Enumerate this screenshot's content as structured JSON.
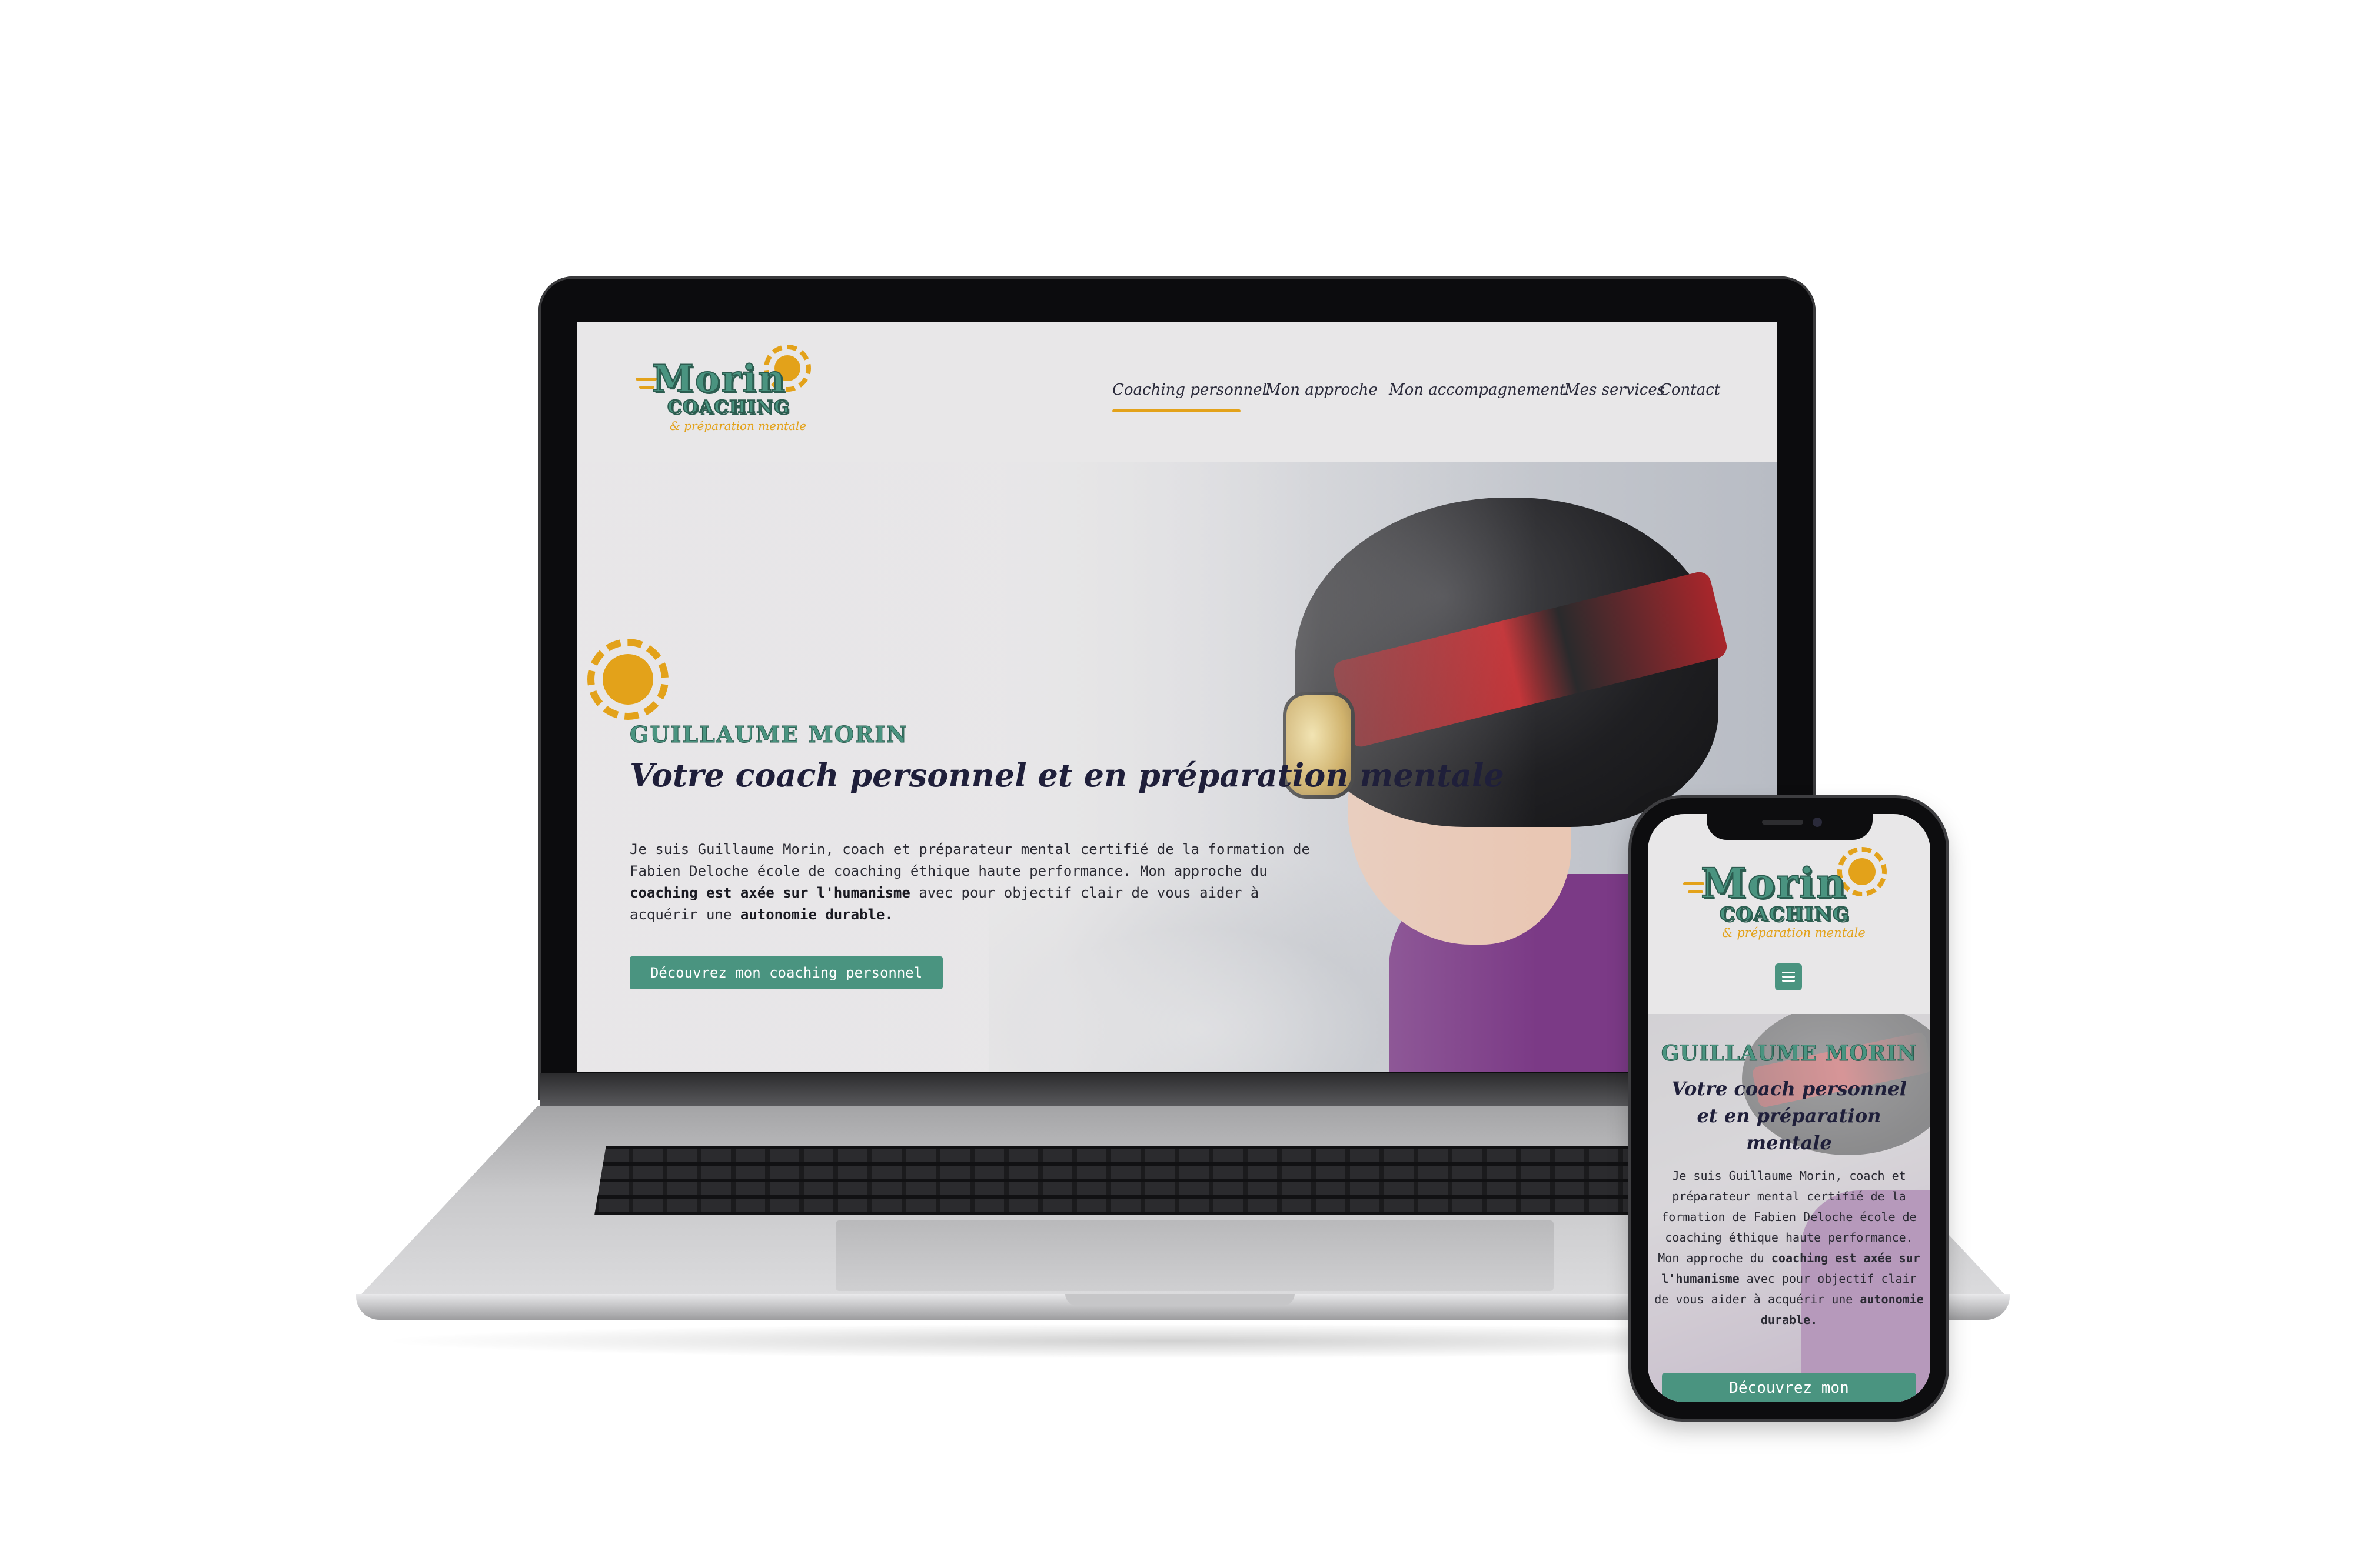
{
  "site": {
    "logo": {
      "word": "Morin",
      "word2": "COACHING",
      "tagline": "& préparation mentale"
    },
    "nav": {
      "items": [
        {
          "label": "Coaching personnel",
          "active": true
        },
        {
          "label": "Mon approche",
          "active": false
        },
        {
          "label": "Mon accompagnement",
          "active": false
        },
        {
          "label": "Mes services",
          "active": false
        },
        {
          "label": "Contact",
          "active": false
        }
      ]
    },
    "hero": {
      "kicker": "GUILLAUME MORIN",
      "title": "Votre coach personnel et en préparation mentale",
      "text_1": "Je suis Guillaume Morin, coach et préparateur mental certifié de la formation de Fabien Deloche école de coaching éthique haute performance. Mon approche du ",
      "text_bold_1": "coaching est axée sur l'humanisme",
      "text_2": " avec pour objectif clair de vous aider à acquérir une ",
      "text_bold_2": "autonomie durable.",
      "text_3": "",
      "button_label": "Découvrez mon coaching personnel"
    }
  },
  "mobile": {
    "button_label": "Découvrez mon",
    "menu_icon": "hamburger-menu-icon"
  },
  "colors": {
    "brand_green": "#4a9480",
    "brand_yellow": "#e3a21a",
    "heading_dark": "#1f1f3a",
    "background": "#e8e7e8",
    "jacket_purple": "#7b3a86"
  },
  "icons": {
    "sun": "sun-icon",
    "menu": "hamburger-menu-icon"
  }
}
